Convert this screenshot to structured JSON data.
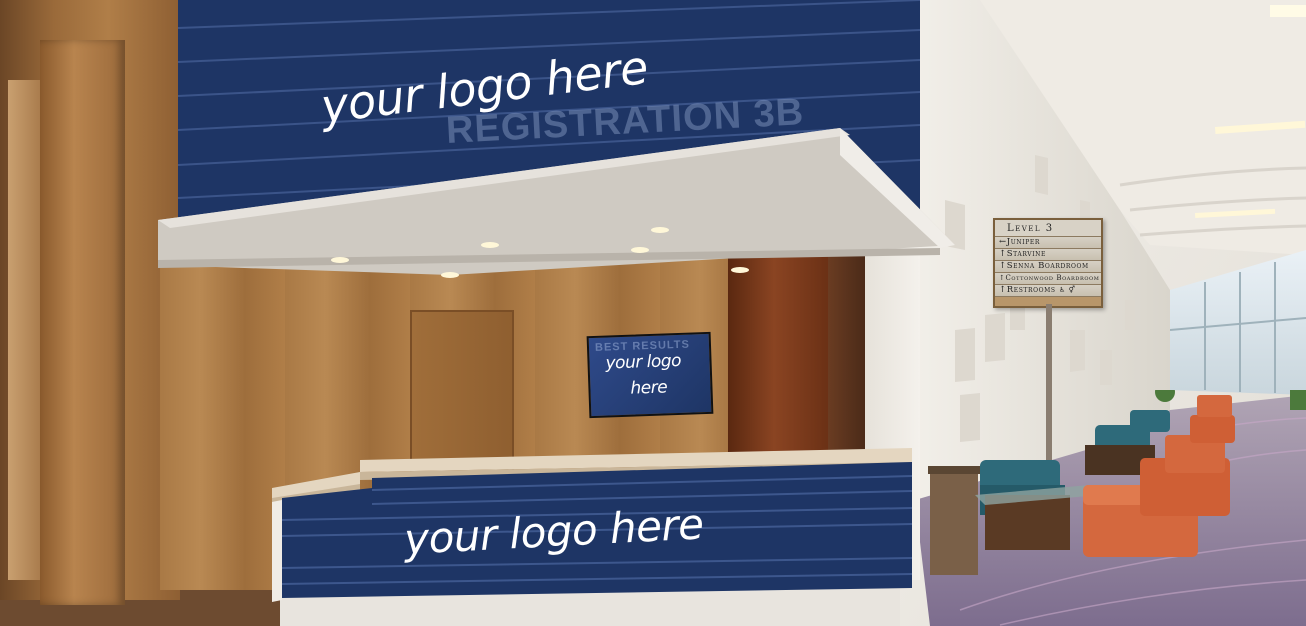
{
  "banner_upper": {
    "logo_text": "your logo here",
    "ghost_text": "REGISTRATION 3B"
  },
  "screen": {
    "logo_text_line1": "your logo",
    "logo_text_line2": "here",
    "ghost_text": "BEST RESULTS"
  },
  "desk_front": {
    "logo_text": "your logo here"
  },
  "wayfinding_sign": {
    "title": "Level 3",
    "rows": [
      {
        "arrow": "←",
        "label": "Juniper"
      },
      {
        "arrow": "↑",
        "label": "Starvine"
      },
      {
        "arrow": "↑",
        "label": "Senna Boardroom"
      },
      {
        "arrow": "↑",
        "label": "Cottonwood Boardroom"
      },
      {
        "arrow": "↑",
        "label": "Restrooms",
        "suffix": "♿︎ ⚥"
      }
    ]
  },
  "colors": {
    "banner_navy": "#1e3565",
    "wood": "#a87a45",
    "carpet": "#8a7a96",
    "chair_orange": "#d4683e",
    "sofa_teal": "#2e6a7a"
  }
}
